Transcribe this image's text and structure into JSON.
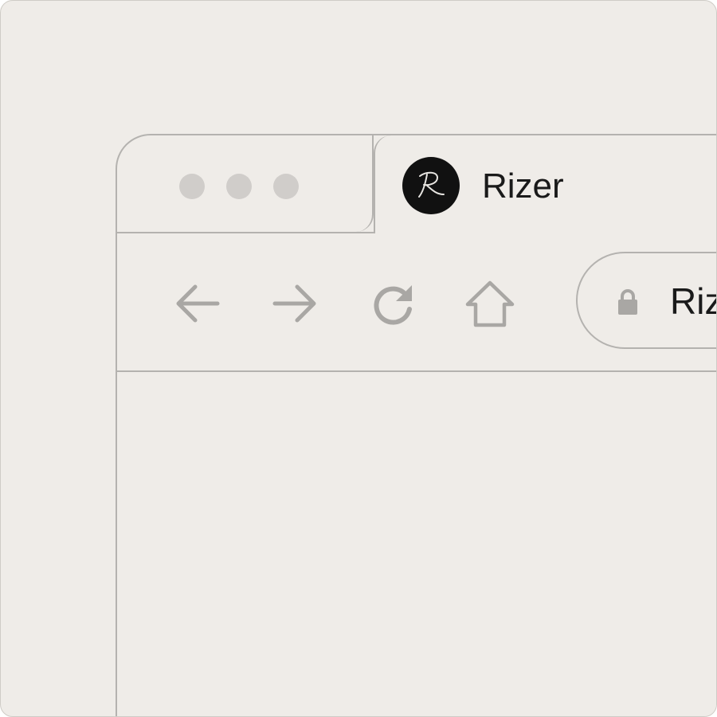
{
  "window_controls": {
    "dots": [
      "window-dot",
      "window-dot",
      "window-dot"
    ],
    "dot_color": "#d0cdca"
  },
  "tab": {
    "title": "Rizer",
    "favicon_letter": "R",
    "favicon_bg": "#111111"
  },
  "toolbar": {
    "icons": [
      "back-arrow-icon",
      "forward-arrow-icon",
      "reload-icon",
      "home-icon"
    ],
    "icon_color": "#a9a7a4"
  },
  "address_bar": {
    "url_text": "Rizer",
    "lock_icon": "lock-icon"
  },
  "colors": {
    "background": "#efece8",
    "border": "#b4b2af"
  }
}
